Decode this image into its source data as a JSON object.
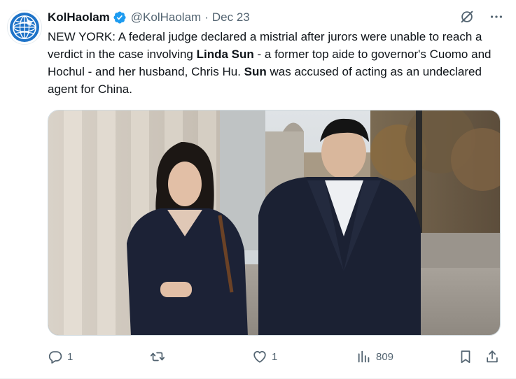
{
  "tweet": {
    "display_name": "KolHaolam",
    "handle": "@KolHaolam",
    "separator": "·",
    "date": "Dec 23",
    "text_parts": {
      "p1": "NEW YORK: A federal judge declared a mistrial after jurors were unable to reach a verdict in the case involving ",
      "b1": "Linda Sun",
      "p2": " - a former top aide to governor's Cuomo and Hochul - and her husband, Chris Hu. ",
      "b2": "Sun",
      "p3": " was accused of acting as an undeclared agent for China."
    },
    "media_alt": "Linda Sun and Chris Hu walking outside a courthouse",
    "metrics": {
      "replies": "1",
      "reposts": "",
      "likes": "1",
      "views": "809"
    }
  },
  "icons": {
    "avatar": "globe-logo",
    "verified": "verified-badge-icon",
    "grok": "grok-icon",
    "more": "more-dots-icon",
    "reply": "reply-icon",
    "repost": "repost-icon",
    "like": "like-icon",
    "views": "views-icon",
    "bookmark": "bookmark-icon",
    "share": "share-icon"
  },
  "colors": {
    "text_primary": "#0f1419",
    "text_secondary": "#536471",
    "verified_blue": "#1d9bf0",
    "avatar_blue": "#1e73c8"
  }
}
